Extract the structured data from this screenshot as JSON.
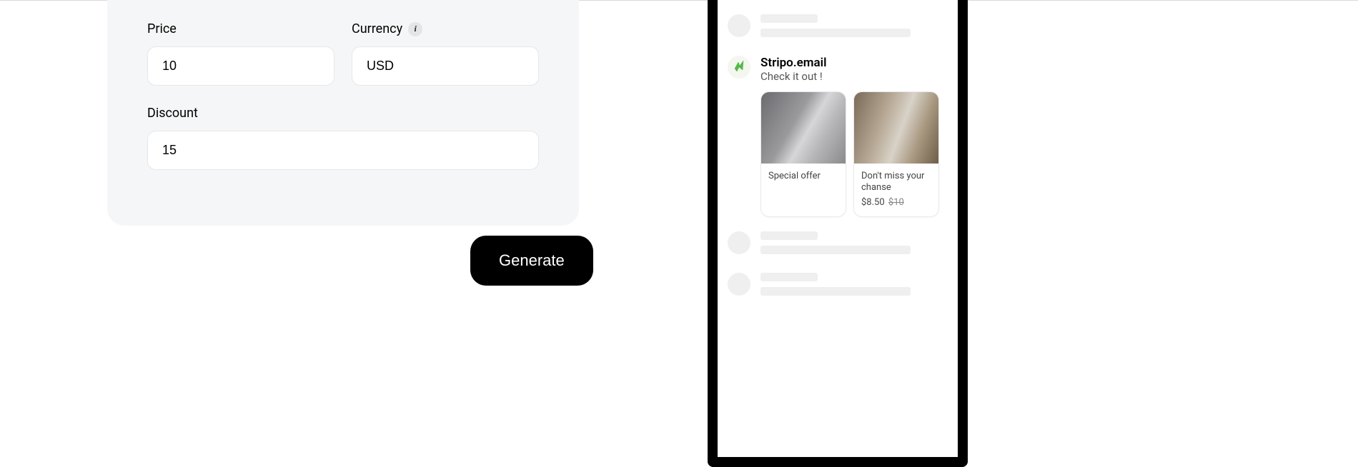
{
  "form": {
    "price_label": "Price",
    "price_value": "10",
    "currency_label": "Currency",
    "currency_value": "USD",
    "discount_label": "Discount",
    "discount_value": "15"
  },
  "actions": {
    "generate_label": "Generate"
  },
  "preview": {
    "sender": "Stripo.email",
    "subject": "Check it out !",
    "card1_title": "Special offer",
    "card2_title": "Don't miss your chanse",
    "card2_price": "$8.50",
    "card2_oldprice": "$10"
  }
}
